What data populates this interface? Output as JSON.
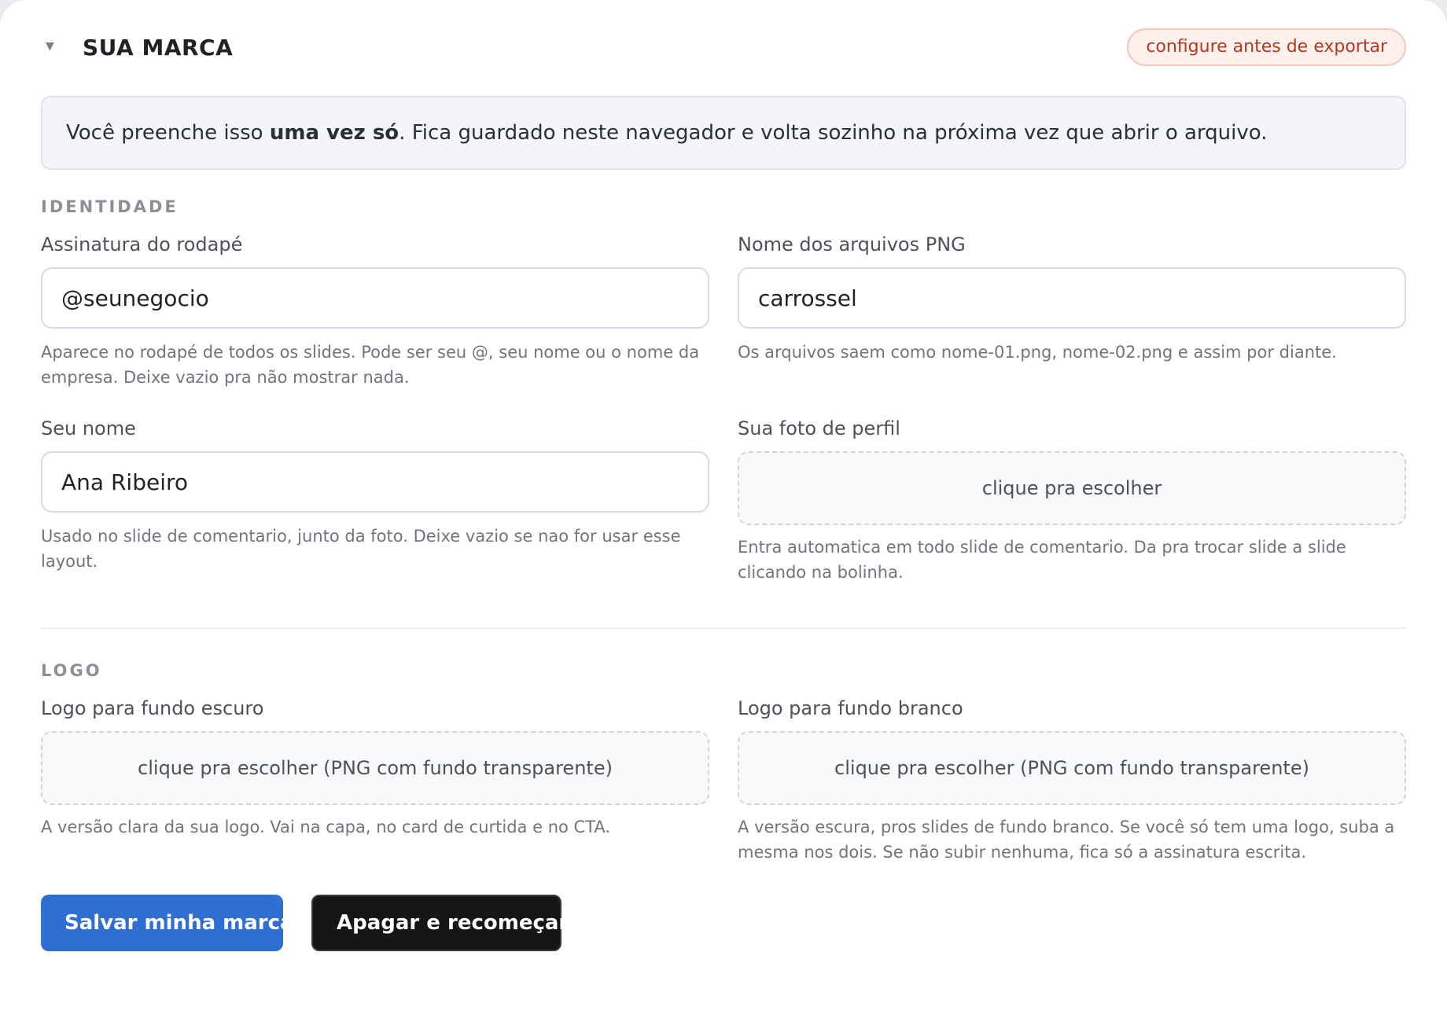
{
  "header": {
    "title": "SUA MARCA",
    "caret": "▼",
    "badge": "configure antes de exportar"
  },
  "info": {
    "before": "Você preenche isso ",
    "bold": "uma vez só",
    "after": ". Fica guardado neste navegador e volta sozinho na próxima vez que abrir o arquivo."
  },
  "identity": {
    "section_title": "IDENTIDADE",
    "footer_signature": {
      "label": "Assinatura do rodapé",
      "value": "@seunegocio",
      "help": "Aparece no rodapé de todos os slides. Pode ser seu @, seu nome ou o nome da empresa. Deixe vazio pra não mostrar nada."
    },
    "file_name": {
      "label": "Nome dos arquivos PNG",
      "value": "carrossel",
      "help": "Os arquivos saem como nome-01.png, nome-02.png e assim por diante."
    },
    "your_name": {
      "label": "Seu nome",
      "value": "Ana Ribeiro",
      "help": "Usado no slide de comentario, junto da foto. Deixe vazio se nao for usar esse layout."
    },
    "profile_photo": {
      "label": "Sua foto de perfil",
      "picker": "clique pra escolher",
      "help": "Entra automatica em todo slide de comentario. Da pra trocar slide a slide clicando na bolinha."
    }
  },
  "logo": {
    "section_title": "LOGO",
    "dark_bg": {
      "label": "Logo para fundo escuro",
      "picker": "clique pra escolher (PNG com fundo transparente)",
      "help": "A versão clara da sua logo. Vai na capa, no card de curtida e no CTA."
    },
    "white_bg": {
      "label": "Logo para fundo branco",
      "picker": "clique pra escolher (PNG com fundo transparente)",
      "help": "A versão escura, pros slides de fundo branco. Se você só tem uma logo, suba a mesma nos dois. Se não subir nenhuma, fica só a assinatura escrita."
    }
  },
  "actions": {
    "save": "Salvar minha marca",
    "reset": "Apagar e recomeçar"
  },
  "colors": {
    "primary": "#2f6fd4",
    "dark": "#161616",
    "badge_text": "#b23a22",
    "badge_bg": "#fdf0ed"
  }
}
